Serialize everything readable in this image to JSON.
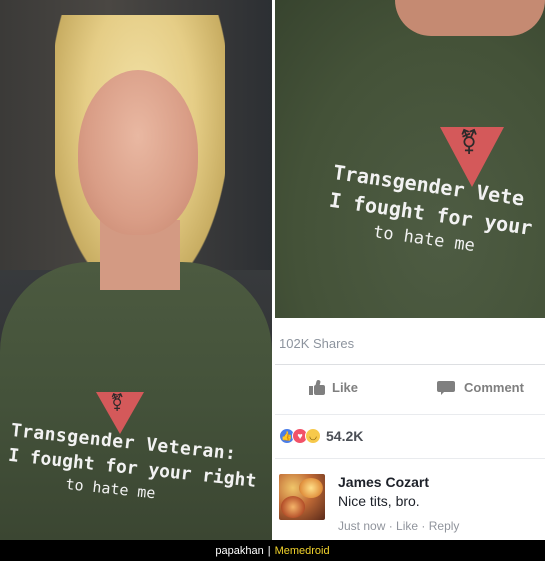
{
  "left_photo": {
    "shirt_line1": "Transgender Veteran:",
    "shirt_line2": "I fought for your right",
    "shirt_line3": "to hate me"
  },
  "right_photo": {
    "shirt_line1": "Transgender Vete",
    "shirt_line2": "I fought for your",
    "shirt_line3": "to hate me"
  },
  "post": {
    "shares": "102K Shares",
    "like_label": "Like",
    "comment_label": "Comment",
    "reaction_count": "54.2K",
    "reactions": [
      "like",
      "love",
      "haha"
    ]
  },
  "comment": {
    "author": "James Cozart",
    "text": "Nice tits, bro.",
    "time": "Just now",
    "like_action": "Like",
    "reply_action": "Reply"
  },
  "watermark": {
    "user": "papakhan",
    "separator": "|",
    "brand": "Memedroid",
    "brand_color": "#f2d32b"
  }
}
